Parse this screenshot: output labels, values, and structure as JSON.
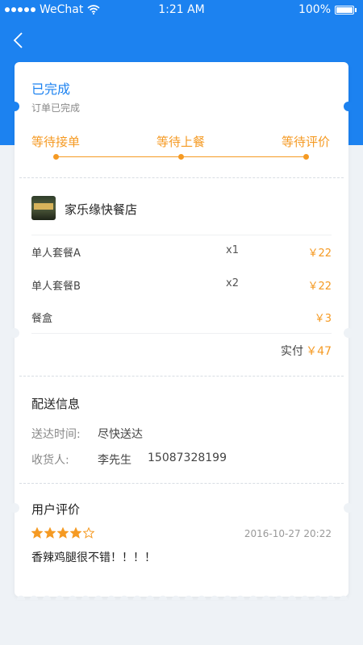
{
  "status_bar": {
    "carrier": "WeChat",
    "time": "1:21 AM",
    "battery": "100%"
  },
  "order_status": {
    "title": "已完成",
    "subtitle": "订单已完成"
  },
  "progress_steps": [
    "等待接单",
    "等待上餐",
    "等待评价"
  ],
  "shop": {
    "name": "家乐缘快餐店",
    "logo_icon": "restaurant-photo"
  },
  "items": [
    {
      "name": "单人套餐A",
      "qty": "x1",
      "price": "￥22"
    },
    {
      "name": "单人套餐B",
      "qty": "x2",
      "price": "￥22"
    },
    {
      "name": "餐盒",
      "qty": "",
      "price": "￥3"
    }
  ],
  "payment": {
    "label": "实付",
    "amount": "￥47"
  },
  "delivery": {
    "title": "配送信息",
    "time_label": "送达时间:",
    "time_value": "尽快送达",
    "receiver_label": "收货人:",
    "receiver_name": "李先生",
    "receiver_phone": "15087328199"
  },
  "review": {
    "title": "用户评价",
    "rating": 4,
    "max_rating": 5,
    "datetime": "2016-10-27 20:22",
    "text": "香辣鸡腿很不错！！！！"
  },
  "colors": {
    "primary": "#1c82f0",
    "accent": "#f59a23",
    "background": "#eef2f6"
  }
}
